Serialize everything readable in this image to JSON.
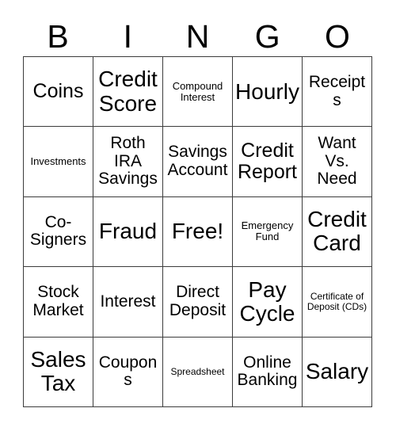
{
  "header": {
    "letters": [
      "B",
      "I",
      "N",
      "G",
      "O"
    ]
  },
  "grid": {
    "rows": 5,
    "columns": 5,
    "border_color": "#3c3c3c",
    "cell_background": "#ffffff",
    "text_color": "#000000",
    "cells": [
      {
        "label": "Coins",
        "size": "lg"
      },
      {
        "label": "Credit Score",
        "size": "xl"
      },
      {
        "label": "Compound Interest",
        "size": "xs"
      },
      {
        "label": "Hourly",
        "size": "xl"
      },
      {
        "label": "Receipts",
        "size": "md"
      },
      {
        "label": "Investments",
        "size": "xs"
      },
      {
        "label": "Roth IRA Savings",
        "size": "md"
      },
      {
        "label": "Savings Account",
        "size": "md"
      },
      {
        "label": "Credit Report",
        "size": "lg"
      },
      {
        "label": "Want Vs. Need",
        "size": "md"
      },
      {
        "label": "Co-Signers",
        "size": "md"
      },
      {
        "label": "Fraud",
        "size": "xl"
      },
      {
        "label": "Free!",
        "size": "xl"
      },
      {
        "label": "Emergency Fund",
        "size": "xs"
      },
      {
        "label": "Credit Card",
        "size": "xl"
      },
      {
        "label": "Stock Market",
        "size": "md"
      },
      {
        "label": "Interest",
        "size": "md"
      },
      {
        "label": "Direct Deposit",
        "size": "md"
      },
      {
        "label": "Pay Cycle",
        "size": "xl"
      },
      {
        "label": "Certificate of Deposit (CDs)",
        "size": "xxs"
      },
      {
        "label": "Sales Tax",
        "size": "xl"
      },
      {
        "label": "Coupons",
        "size": "md"
      },
      {
        "label": "Spreadsheet",
        "size": "xxs"
      },
      {
        "label": "Online Banking",
        "size": "md"
      },
      {
        "label": "Salary",
        "size": "xl"
      }
    ]
  }
}
